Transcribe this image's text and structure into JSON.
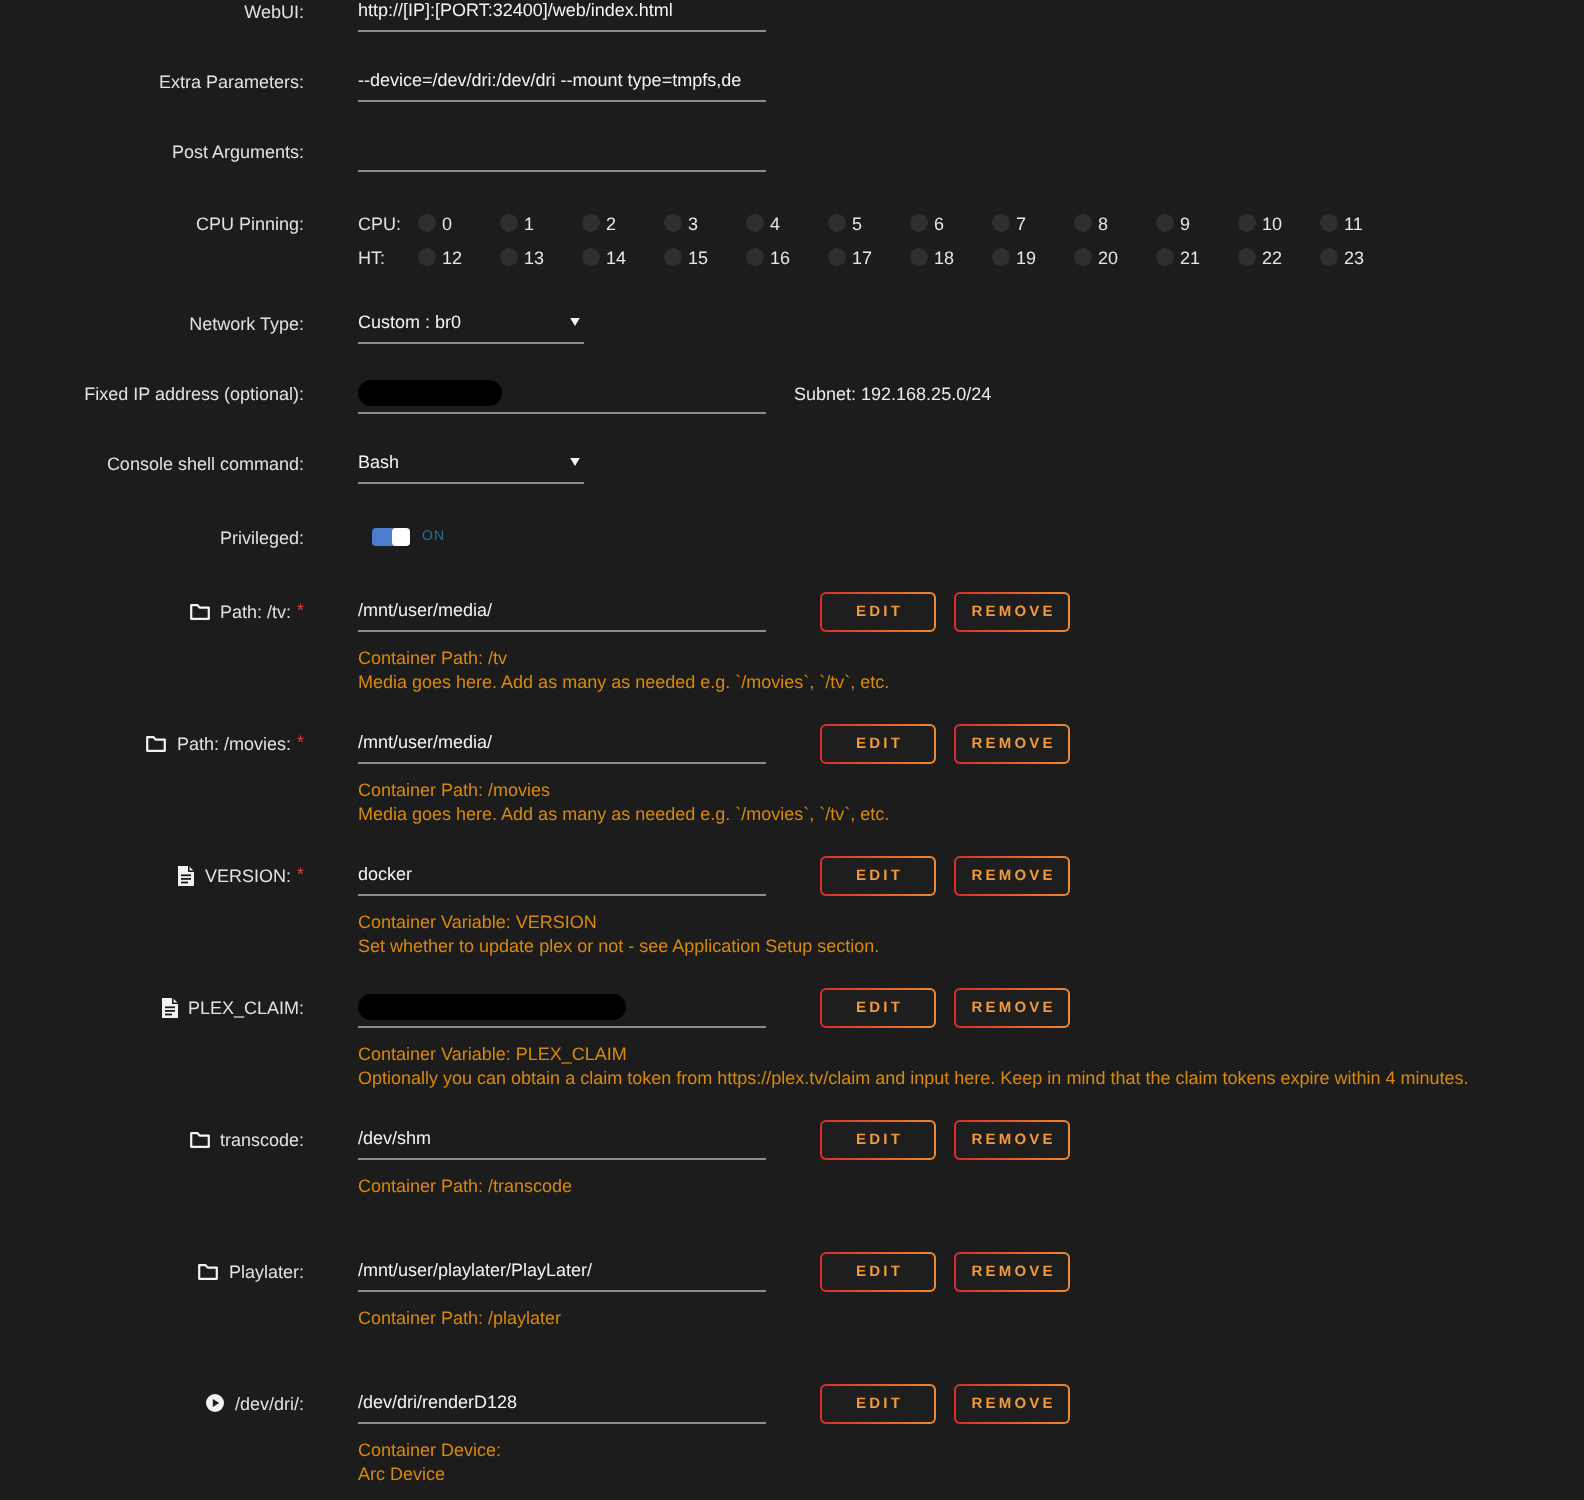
{
  "settings": [
    {
      "kind": "text",
      "label": "WebUI:",
      "value": "http://[IP]:[PORT:32400]/web/index.html"
    },
    {
      "kind": "text",
      "label": "Extra Parameters:",
      "value": "--device=/dev/dri:/dev/dri --mount type=tmpfs,de"
    },
    {
      "kind": "text",
      "label": "Post Arguments:"
    },
    {
      "kind": "cpu_pinning",
      "label": "CPU Pinning:",
      "groups": [
        {
          "label": "CPU:",
          "cores": [
            {
              "number": "0",
              "checked": false
            },
            {
              "number": "1",
              "checked": false
            },
            {
              "number": "2",
              "checked": false
            },
            {
              "number": "3",
              "checked": false
            },
            {
              "number": "4",
              "checked": false
            },
            {
              "number": "5",
              "checked": false
            },
            {
              "number": "6",
              "checked": false
            },
            {
              "number": "7",
              "checked": false
            },
            {
              "number": "8",
              "checked": false
            },
            {
              "number": "9",
              "checked": false
            },
            {
              "number": "10",
              "checked": false
            },
            {
              "number": "11",
              "checked": false
            }
          ]
        },
        {
          "label": "HT:",
          "cores": [
            {
              "number": "12",
              "checked": false
            },
            {
              "number": "13",
              "checked": false
            },
            {
              "number": "14",
              "checked": false
            },
            {
              "number": "15",
              "checked": false
            },
            {
              "number": "16",
              "checked": false
            },
            {
              "number": "17",
              "checked": false
            },
            {
              "number": "18",
              "checked": false
            },
            {
              "number": "19",
              "checked": false
            },
            {
              "number": "20",
              "checked": false
            },
            {
              "number": "21",
              "checked": false
            },
            {
              "number": "22",
              "checked": false
            },
            {
              "number": "23",
              "checked": false
            }
          ]
        }
      ]
    },
    {
      "kind": "select",
      "label": "Network Type:",
      "value": "Custom : br0"
    },
    {
      "kind": "text",
      "label": "Fixed IP address (optional):",
      "redacted": true,
      "note": "Subnet: 192.168.25.0/24"
    },
    {
      "kind": "select",
      "label": "Console shell command:",
      "value": "Bash"
    },
    {
      "kind": "toggle",
      "label": "Privileged:",
      "on": true,
      "state_text": "ON"
    }
  ],
  "mappings": [
    {
      "kind": "path",
      "label": "Path: /tv:",
      "required_mark": "*",
      "value": "/mnt/user/media/",
      "help": [
        "Container Path: /tv",
        "Media goes here. Add as many as needed e.g. `/movies`, `/tv`, etc."
      ],
      "buttons": [
        "EDIT",
        "REMOVE"
      ]
    },
    {
      "kind": "path",
      "label": "Path: /movies:",
      "required_mark": "*",
      "value": "/mnt/user/media/",
      "help": [
        "Container Path: /movies",
        "Media goes here. Add as many as needed e.g. `/movies`, `/tv`, etc."
      ],
      "buttons": [
        "EDIT",
        "REMOVE"
      ]
    },
    {
      "kind": "variable",
      "label": "VERSION:",
      "required_mark": "*",
      "value": "docker",
      "help": [
        "Container Variable: VERSION",
        "Set whether to update plex or not - see Application Setup section."
      ],
      "buttons": [
        "EDIT",
        "REMOVE"
      ]
    },
    {
      "kind": "variable",
      "label": "PLEX_CLAIM:",
      "redacted": true,
      "help": [
        "Container Variable: PLEX_CLAIM",
        "Optionally you can obtain a claim token from https://plex.tv/claim and input here. Keep in mind that the claim tokens expire within 4 minutes."
      ],
      "buttons": [
        "EDIT",
        "REMOVE"
      ]
    },
    {
      "kind": "path",
      "label": "transcode:",
      "value": "/dev/shm",
      "help": [
        "Container Path: /transcode"
      ],
      "buttons": [
        "EDIT",
        "REMOVE"
      ]
    },
    {
      "kind": "path",
      "label": "Playlater:",
      "value": "/mnt/user/playlater/PlayLater/",
      "help": [
        "Container Path: /playlater"
      ],
      "buttons": [
        "EDIT",
        "REMOVE"
      ]
    },
    {
      "kind": "device",
      "label": "/dev/dri/:",
      "value": "/dev/dri/renderD128",
      "help": [
        "Container Device:",
        "Arc Device"
      ],
      "buttons": [
        "EDIT",
        "REMOVE"
      ]
    }
  ]
}
